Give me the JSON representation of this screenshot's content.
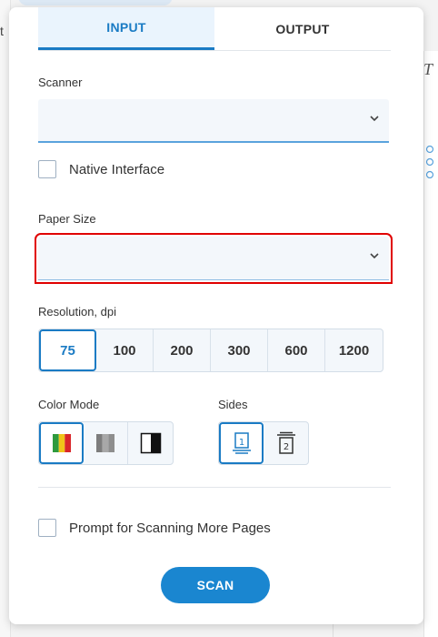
{
  "background": {
    "left_text": "t",
    "right_text": "T"
  },
  "tabs": [
    {
      "label": "INPUT",
      "active": true
    },
    {
      "label": "OUTPUT",
      "active": false
    }
  ],
  "scanner": {
    "label": "Scanner",
    "value": ""
  },
  "native_interface": {
    "label": "Native Interface",
    "checked": false
  },
  "paper_size": {
    "label": "Paper Size",
    "value": ""
  },
  "resolution": {
    "label": "Resolution, dpi",
    "options": [
      "75",
      "100",
      "200",
      "300",
      "600",
      "1200"
    ],
    "selected": "75"
  },
  "color_mode": {
    "label": "Color Mode",
    "options": [
      "color-mode-icon",
      "grayscale-mode-icon",
      "black-white-mode-icon"
    ],
    "selected": "color-mode-icon"
  },
  "sides": {
    "label": "Sides",
    "options": [
      "single-sided-icon",
      "double-sided-icon"
    ],
    "selected": "single-sided-icon"
  },
  "prompt_more_pages": {
    "label": "Prompt for Scanning More Pages",
    "checked": false
  },
  "scan_button": {
    "label": "SCAN"
  },
  "colors": {
    "accent": "#1a7bc4",
    "button": "#1a86d0",
    "highlight_border": "#e00000"
  }
}
